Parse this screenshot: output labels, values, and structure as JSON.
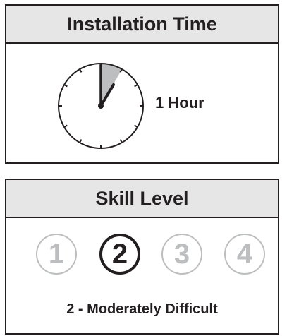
{
  "installation_time": {
    "title": "Installation Time",
    "duration": "1 Hour",
    "clock_icon": "clock-icon"
  },
  "skill_level": {
    "title": "Skill Level",
    "levels": [
      "1",
      "2",
      "3",
      "4"
    ],
    "selected": "2",
    "description": "2 - Moderately Difficult"
  },
  "colors": {
    "border": "#231f20",
    "header_bg": "#e6e6e6",
    "inactive": "#bcbec0",
    "clock_sector": "#bcbec0"
  }
}
